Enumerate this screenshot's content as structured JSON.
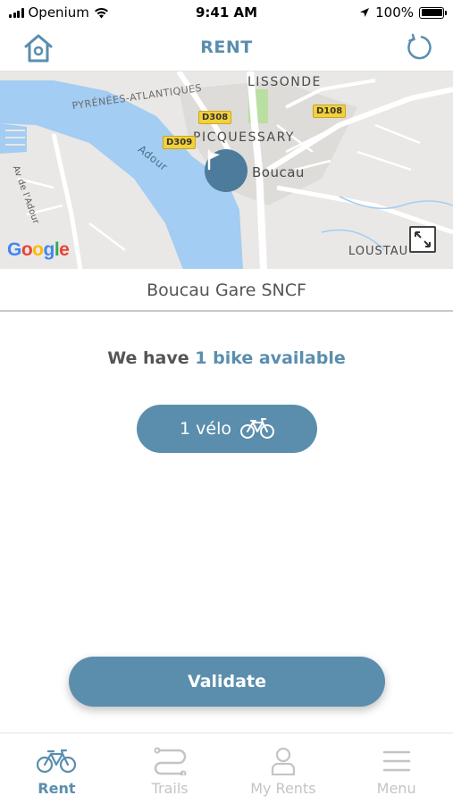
{
  "status_bar": {
    "carrier": "Openium",
    "time": "9:41 AM",
    "battery": "100%",
    "battery_level": 1.0
  },
  "header": {
    "title": "RENT",
    "home_icon": "home-icon",
    "refresh_icon": "refresh-icon"
  },
  "map": {
    "labels": {
      "lissonde": "LISSONDE",
      "pyrenees": "PYRÉNÉES-ATLANTIQUES",
      "picquessary": "PICQUESSARY",
      "boucau": "Boucau",
      "adour": "Adour",
      "av_adour": "Av de l'Adour",
      "loustau": "LOUSTAU"
    },
    "roads": [
      "D308",
      "D108",
      "D309"
    ],
    "attribution": "Google",
    "pin_icon": "flag-icon",
    "expand_icon": "expand-icon"
  },
  "station": {
    "name": "Boucau Gare SNCF"
  },
  "availability": {
    "prefix": "We have",
    "highlight": "1 bike available"
  },
  "bike_button": {
    "label": "1 vélo",
    "icon": "bike-icon"
  },
  "validate_button": {
    "label": "Validate"
  },
  "tabs": [
    {
      "label": "Rent",
      "icon": "bike-icon",
      "active": true
    },
    {
      "label": "Trails",
      "icon": "trail-icon",
      "active": false
    },
    {
      "label": "My Rents",
      "icon": "user-icon",
      "active": false
    },
    {
      "label": "Menu",
      "icon": "menu-icon",
      "active": false
    }
  ],
  "colors": {
    "accent": "#5a8eae",
    "button": "#5b8ead",
    "pin": "#4d7b9b",
    "river": "#a3cdf2",
    "inactive_tab": "#c4c4c4"
  }
}
